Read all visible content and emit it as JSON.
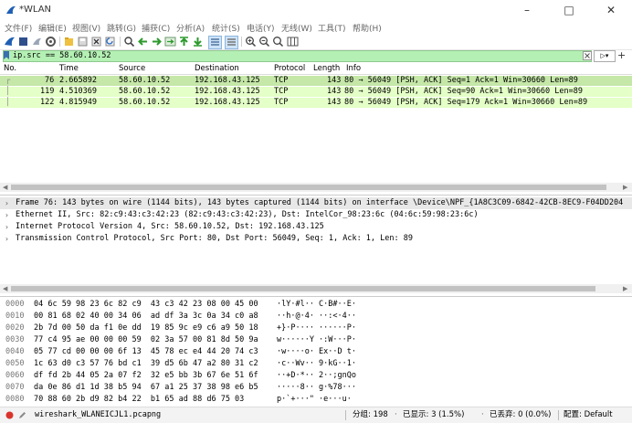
{
  "window": {
    "title": "*WLAN"
  },
  "menu": [
    "文件(F)",
    "编辑(E)",
    "视图(V)",
    "跳转(G)",
    "捕获(C)",
    "分析(A)",
    "统计(S)",
    "电话(Y)",
    "无线(W)",
    "工具(T)",
    "帮助(H)"
  ],
  "filter": {
    "value": "ip.src == 58.60.10.52"
  },
  "packet_list": {
    "columns": [
      "No.",
      "Time",
      "Source",
      "Destination",
      "Protocol",
      "Length",
      "Info"
    ],
    "rows": [
      {
        "no": "76",
        "time": "2.665892",
        "source": "58.60.10.52",
        "destination": "192.168.43.125",
        "protocol": "TCP",
        "length": "143",
        "info": "80 → 56049 [PSH, ACK] Seq=1 Ack=1 Win=30660 Len=89"
      },
      {
        "no": "119",
        "time": "4.510369",
        "source": "58.60.10.52",
        "destination": "192.168.43.125",
        "protocol": "TCP",
        "length": "143",
        "info": "80 → 56049 [PSH, ACK] Seq=90 Ack=1 Win=30660 Len=89"
      },
      {
        "no": "122",
        "time": "4.815949",
        "source": "58.60.10.52",
        "destination": "192.168.43.125",
        "protocol": "TCP",
        "length": "143",
        "info": "80 → 56049 [PSH, ACK] Seq=179 Ack=1 Win=30660 Len=89"
      }
    ]
  },
  "details": [
    "Frame 76: 143 bytes on wire (1144 bits), 143 bytes captured (1144 bits) on interface \\Device\\NPF_{1A8C3C09-6842-42CB-8EC9-F04DD204",
    "Ethernet II, Src: 82:c9:43:c3:42:23 (82:c9:43:c3:42:23), Dst: IntelCor_98:23:6c (04:6c:59:98:23:6c)",
    "Internet Protocol Version 4, Src: 58.60.10.52, Dst: 192.168.43.125",
    "Transmission Control Protocol, Src Port: 80, Dst Port: 56049, Seq: 1, Ack: 1, Len: 89"
  ],
  "bytes": [
    {
      "offset": "0000",
      "hex": "04 6c 59 98 23 6c 82 c9  43 c3 42 23 08 00 45 00",
      "ascii": "·lY·#l·· C·B#··E·"
    },
    {
      "offset": "0010",
      "hex": "00 81 68 02 40 00 34 06  ad df 3a 3c 0a 34 c0 a8",
      "ascii": "··h·@·4· ··:<·4··"
    },
    {
      "offset": "0020",
      "hex": "2b 7d 00 50 da f1 0e dd  19 85 9c e9 c6 a9 50 18",
      "ascii": "+}·P···· ······P·"
    },
    {
      "offset": "0030",
      "hex": "77 c4 95 ae 00 00 00 59  02 3a 57 00 81 8d 50 9a",
      "ascii": "w······Y ·:W···P·"
    },
    {
      "offset": "0040",
      "hex": "05 77 cd 00 00 00 6f 13  45 78 ec e4 44 20 74 c3",
      "ascii": "·w····o· Ex··D t·"
    },
    {
      "offset": "0050",
      "hex": "1c 63 d0 c3 57 76 bd c1  39 d5 6b 47 a2 80 31 c2",
      "ascii": "·c··Wv·· 9·kG··1·"
    },
    {
      "offset": "0060",
      "hex": "df fd 2b 44 05 2a 07 f2  32 e5 bb 3b 67 6e 51 6f",
      "ascii": "··+D·*·· 2··;gnQo"
    },
    {
      "offset": "0070",
      "hex": "da 0e 86 d1 1d 38 b5 94  67 a1 25 37 38 98 e6 b5",
      "ascii": "·····8·· g·%78···"
    },
    {
      "offset": "0080",
      "hex": "70 88 60 2b d9 82 b4 22  b1 65 ad 88 d6 75 03",
      "ascii": "p·`+···\" ·e···u·"
    }
  ],
  "status": {
    "file": "wireshark_WLANEICJL1.pcapng",
    "packets": "分组: 198",
    "displayed": "已显示: 3 (1.5%)",
    "dropped": "已丢弃: 0 (0.0%)",
    "profile": "配置: Default"
  },
  "colors": {
    "row_bg": "#e4ffc7",
    "row_selected": "#c5e7a8",
    "filter_ok": "#b4f0b4",
    "accent_fin": "#1e5fb4"
  }
}
